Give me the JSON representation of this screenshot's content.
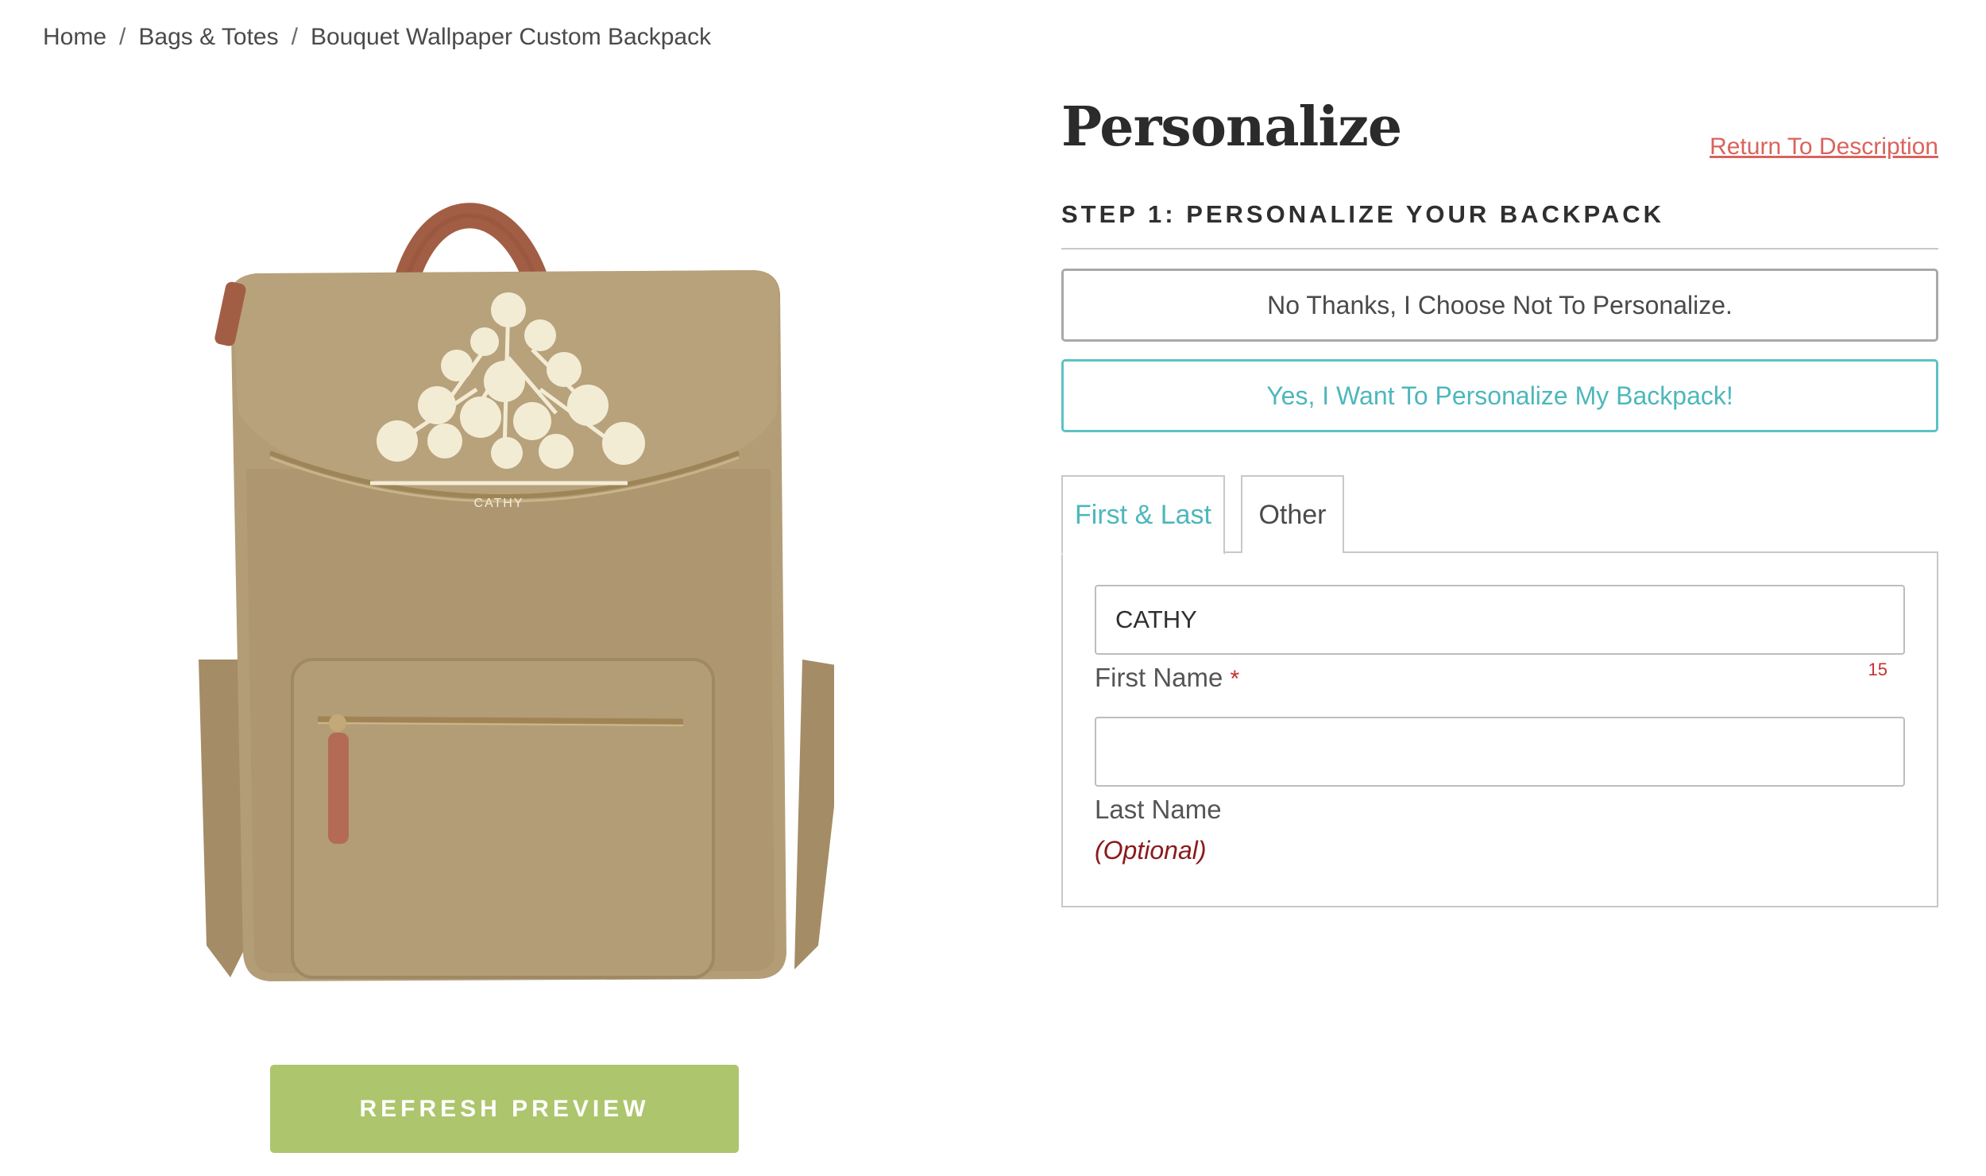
{
  "breadcrumb": {
    "home": "Home",
    "category": "Bags & Totes",
    "current": "Bouquet Wallpaper Custom Backpack",
    "separator": "/"
  },
  "product": {
    "preview_name": "CATHY",
    "refresh_label": "REFRESH PREVIEW"
  },
  "personalize": {
    "title": "Personalize",
    "return_link": "Return To Description",
    "step_title": "STEP 1: PERSONALIZE YOUR BACKPACK",
    "option_no": "No Thanks, I Choose Not To Personalize.",
    "option_yes": "Yes, I Want To Personalize My Backpack!",
    "tabs": [
      {
        "label": "First & Last",
        "active": true
      },
      {
        "label": "Other",
        "active": false
      }
    ],
    "first_name": {
      "value": "CATHY",
      "label": "First Name",
      "required_mark": "*",
      "counter": "15"
    },
    "last_name": {
      "value": "",
      "label": "Last Name",
      "optional": "(Optional)"
    }
  },
  "colors": {
    "accent_teal": "#5cc2c6",
    "link_red": "#d9635d",
    "button_green": "#adc56c",
    "bag_tan": "#b39d77",
    "strap_brown": "#a25e45"
  }
}
